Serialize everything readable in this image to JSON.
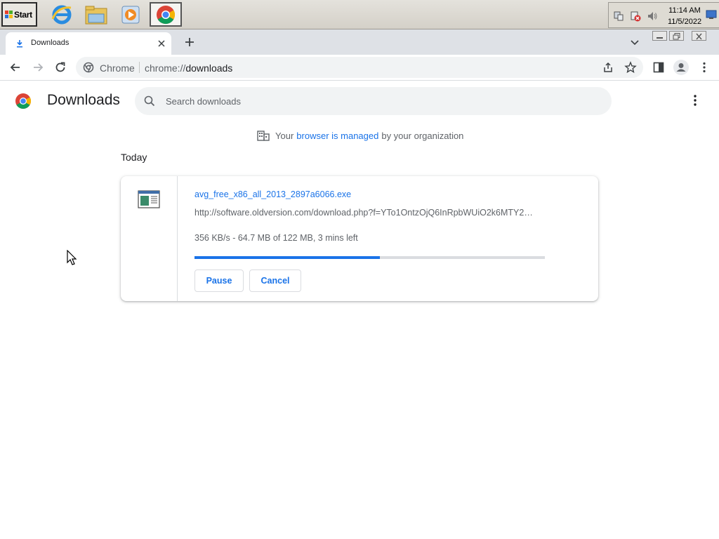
{
  "taskbar": {
    "start_label": "Start",
    "apps": [
      {
        "name": "ie-icon"
      },
      {
        "name": "explorer-icon"
      },
      {
        "name": "media-player-icon"
      },
      {
        "name": "chrome-icon"
      }
    ],
    "clock": {
      "time": "11:14 AM",
      "date": "11/5/2022"
    }
  },
  "browser": {
    "tab": {
      "title": "Downloads"
    },
    "omnibox": {
      "site_name": "Chrome",
      "url_scheme": "chrome://",
      "url_path": "downloads"
    }
  },
  "page": {
    "title": "Downloads",
    "search_placeholder": "Search downloads",
    "managed": {
      "prefix": "Your",
      "link": "browser is managed",
      "suffix": "by your organization"
    },
    "date_group": "Today",
    "download": {
      "file_name": "avg_free_x86_all_2013_2897a6066.exe",
      "url": "http://software.oldversion.com/download.php?f=YTo1OntzOjQ6InRpbWUiO2k6MTY2…",
      "status": "356 KB/s - 64.7 MB of 122 MB, 3 mins left",
      "progress": 0.53,
      "pause_label": "Pause",
      "cancel_label": "Cancel"
    }
  },
  "colors": {
    "accent": "#1a73e8",
    "text": "#202124",
    "secondary_text": "#5f6368"
  }
}
